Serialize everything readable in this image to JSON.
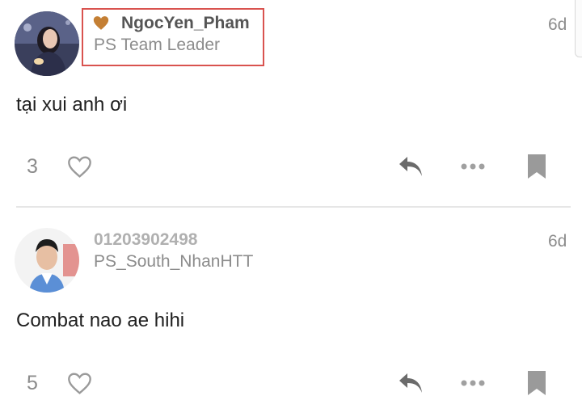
{
  "posts": [
    {
      "author": "NgocYen_Pham",
      "title": "PS Team Leader",
      "time": "6d",
      "content": "tại xui anh ơi",
      "like_count": "3",
      "author_color": "#555555",
      "flair_icon": "heart-icon",
      "flair_color": "#c47f34"
    },
    {
      "author": "01203902498",
      "title": "PS_South_NhanHTT",
      "time": "6d",
      "content": "Combat nao ae hihi",
      "like_count": "5",
      "author_color": "#b0b0b0"
    }
  ],
  "icons": {
    "like": "heart-outline-icon",
    "reply": "reply-icon",
    "more": "more-dots-icon",
    "bookmark": "bookmark-icon"
  },
  "colors": {
    "icon_gray": "#9a9a9a",
    "reply_dark": "#6b6b6b",
    "highlight_border": "#d9534f"
  }
}
